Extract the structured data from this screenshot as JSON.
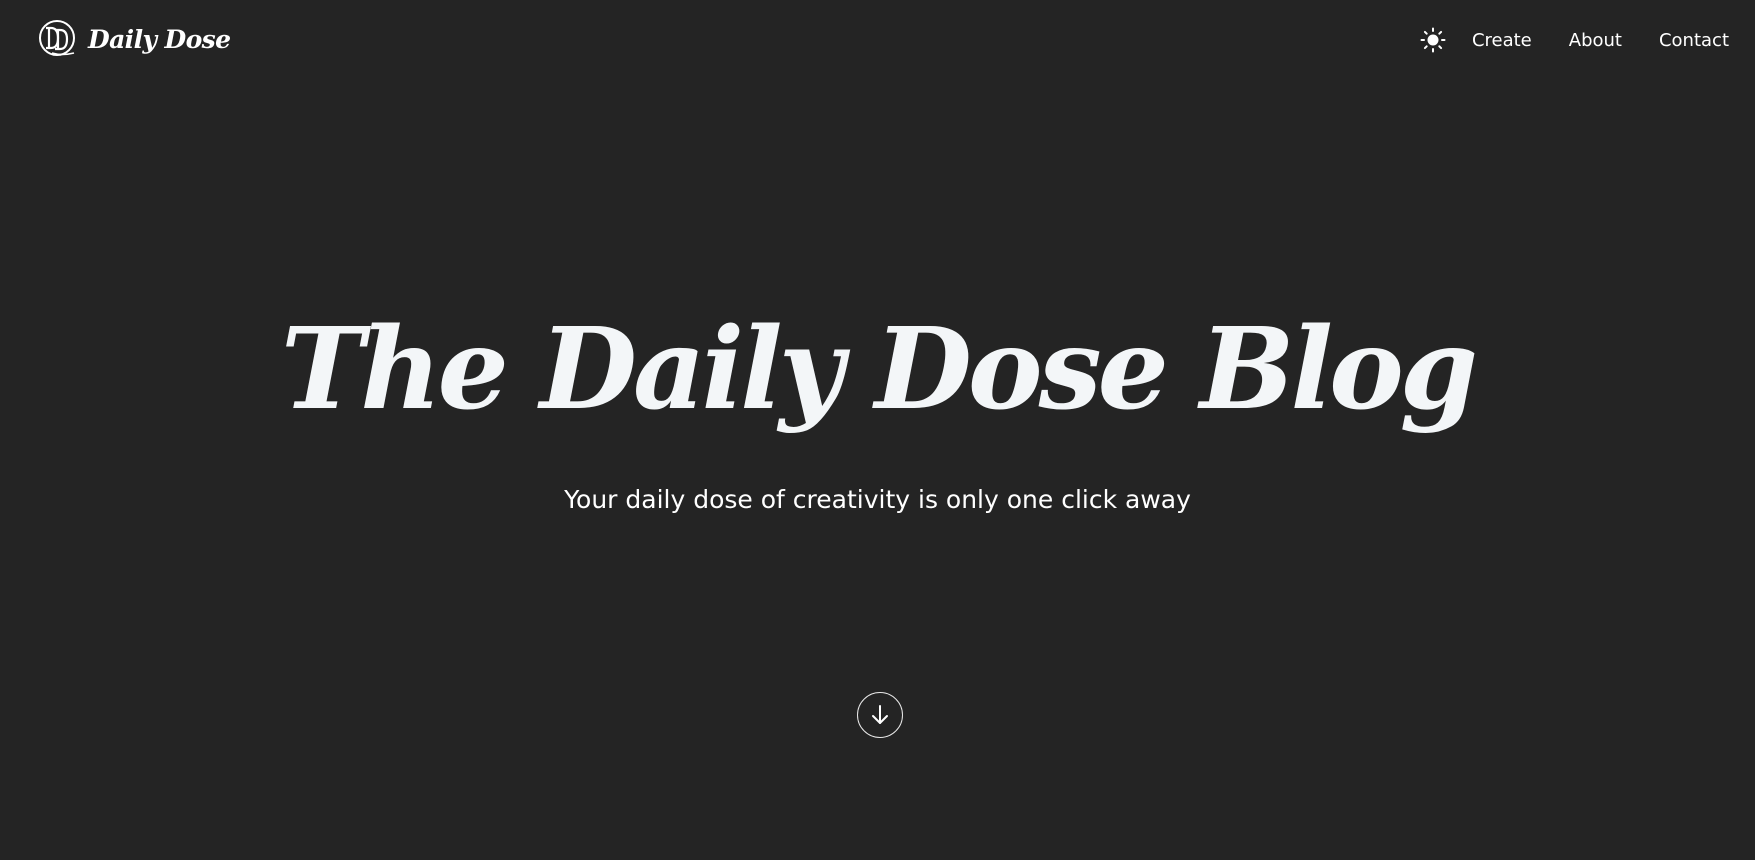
{
  "brand": {
    "logo_monogram": "DD",
    "name": "Daily Dose"
  },
  "nav": {
    "theme_toggle_icon": "sun-icon",
    "links": [
      {
        "label": "Create"
      },
      {
        "label": "About"
      },
      {
        "label": "Contact"
      }
    ]
  },
  "hero": {
    "title": "The Daily Dose Blog",
    "subtitle": "Your daily dose of creativity is only one click away",
    "scroll_icon": "arrow-down-icon"
  },
  "colors": {
    "background": "#242424",
    "text": "#ffffff",
    "title_text": "#f3f6f8"
  }
}
